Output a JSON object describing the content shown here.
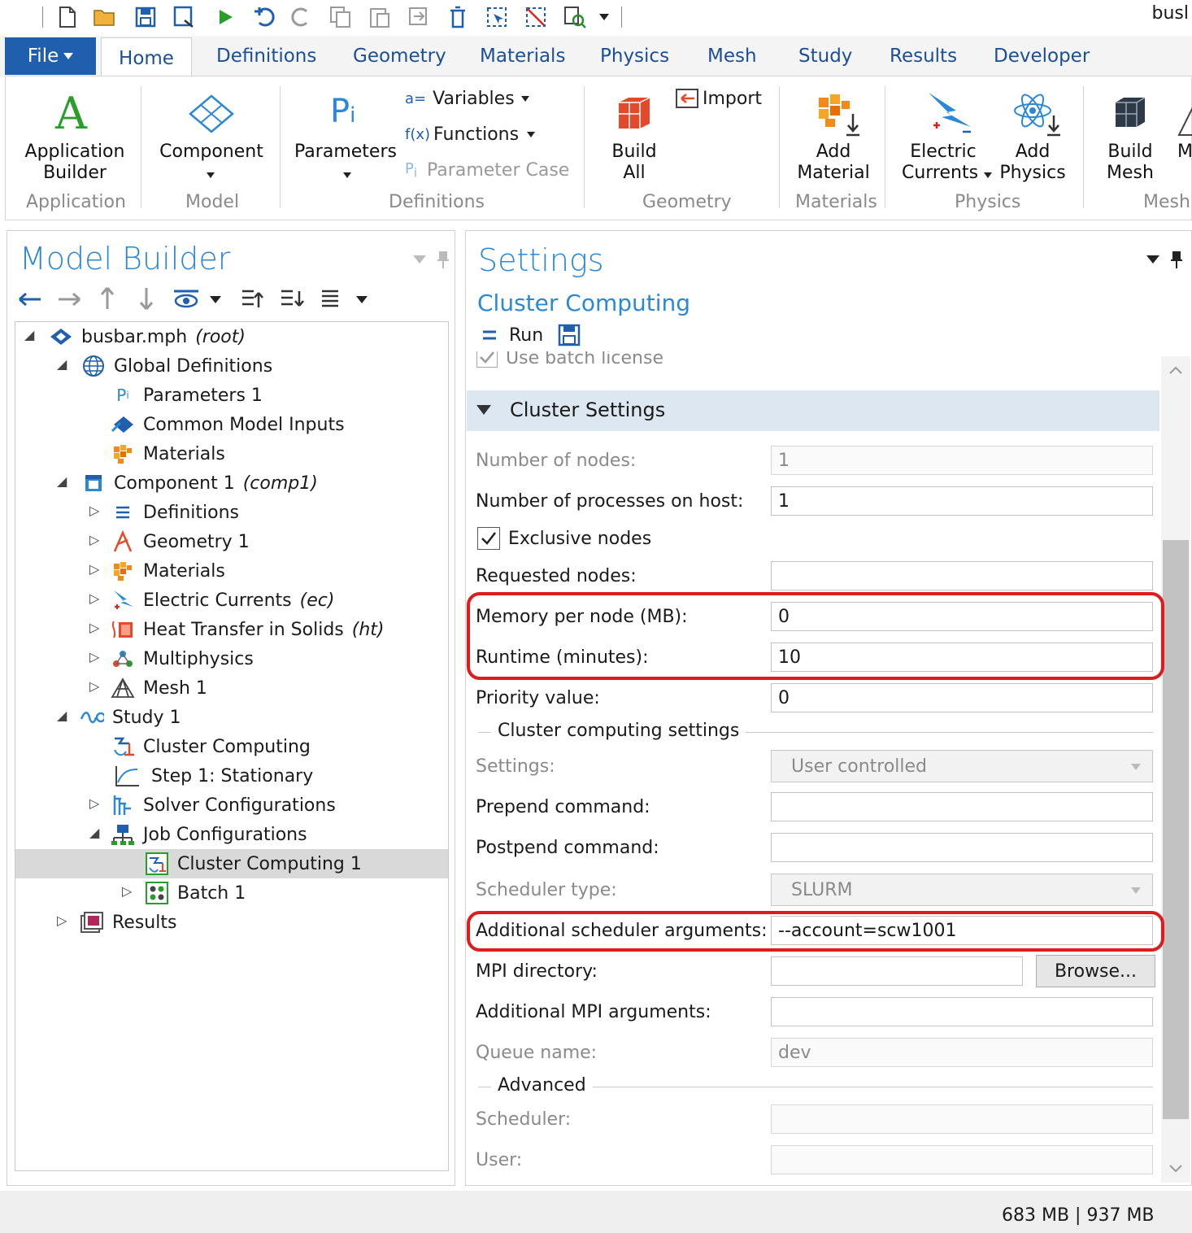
{
  "title_fragment": "busl",
  "tabs": {
    "file": "File",
    "items": [
      "Home",
      "Definitions",
      "Geometry",
      "Materials",
      "Physics",
      "Mesh",
      "Study",
      "Results",
      "Developer"
    ]
  },
  "ribbon": {
    "app_builder": [
      "Application",
      "Builder"
    ],
    "component": "Component",
    "parameters": "Parameters",
    "variables": "Variables",
    "functions": "Functions",
    "parameter_case": "Parameter Case",
    "import": "Import",
    "build_all": [
      "Build",
      "All"
    ],
    "add_material": [
      "Add",
      "Material"
    ],
    "electric_currents": [
      "Electric",
      "Currents"
    ],
    "add_physics": [
      "Add",
      "Physics"
    ],
    "build_mesh": [
      "Build",
      "Mesh"
    ],
    "cut_m": "M",
    "groups": [
      "Application",
      "Model",
      "Definitions",
      "Geometry",
      "Materials",
      "Physics",
      "Mesh"
    ]
  },
  "model_builder": {
    "title": "Model Builder",
    "tree": [
      {
        "label": "busbar.mph",
        "suffix": "(root)"
      },
      {
        "label": "Global Definitions"
      },
      {
        "label": "Parameters 1"
      },
      {
        "label": "Common Model Inputs"
      },
      {
        "label": "Materials"
      },
      {
        "label": "Component 1",
        "suffix": "(comp1)"
      },
      {
        "label": "Definitions"
      },
      {
        "label": "Geometry 1"
      },
      {
        "label": "Materials"
      },
      {
        "label": "Electric Currents",
        "suffix": "(ec)"
      },
      {
        "label": "Heat Transfer in Solids",
        "suffix": "(ht)"
      },
      {
        "label": "Multiphysics"
      },
      {
        "label": "Mesh 1"
      },
      {
        "label": "Study 1"
      },
      {
        "label": "Cluster Computing"
      },
      {
        "label": "Step 1: Stationary"
      },
      {
        "label": "Solver Configurations"
      },
      {
        "label": "Job Configurations"
      },
      {
        "label": "Cluster Computing 1"
      },
      {
        "label": "Batch 1"
      },
      {
        "label": "Results"
      }
    ]
  },
  "settings": {
    "title": "Settings",
    "subtitle": "Cluster Computing",
    "run": "Run",
    "batch_license": "Use batch license",
    "section": "Cluster Settings",
    "fields": {
      "nodes": {
        "label": "Number of nodes:",
        "value": "1"
      },
      "processes": {
        "label": "Number of processes on host:",
        "value": "1"
      },
      "exclusive": {
        "label": "Exclusive nodes"
      },
      "requested": {
        "label": "Requested nodes:",
        "value": ""
      },
      "memory": {
        "label": "Memory per node (MB):",
        "value": "0"
      },
      "runtime": {
        "label": "Runtime (minutes):",
        "value": "10"
      },
      "priority": {
        "label": "Priority value:",
        "value": "0"
      },
      "cc_settings_header": "Cluster computing settings",
      "settings_sel": {
        "label": "Settings:",
        "value": "User controlled"
      },
      "prepend": {
        "label": "Prepend command:",
        "value": ""
      },
      "postpend": {
        "label": "Postpend command:",
        "value": ""
      },
      "scheduler_type": {
        "label": "Scheduler type:",
        "value": "SLURM"
      },
      "sched_args": {
        "label": "Additional scheduler arguments:",
        "value": "--account=scw1001"
      },
      "mpi_dir": {
        "label": "MPI directory:",
        "value": "",
        "browse": "Browse..."
      },
      "mpi_args": {
        "label": "Additional MPI arguments:",
        "value": ""
      },
      "queue": {
        "label": "Queue name:",
        "value": "dev"
      },
      "advanced_header": "Advanced",
      "scheduler": {
        "label": "Scheduler:",
        "value": ""
      },
      "user": {
        "label": "User:",
        "value": ""
      }
    }
  },
  "status": {
    "memory": "683 MB | 937 MB"
  },
  "colors": {
    "accent": "#1f5fae",
    "highlight": "#e01b1b",
    "title_blue": "#2b88d8"
  }
}
